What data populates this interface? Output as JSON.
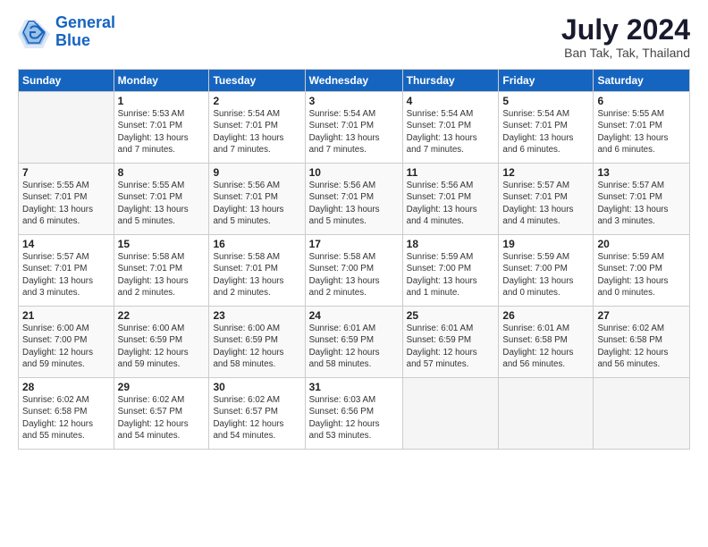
{
  "logo": {
    "line1": "General",
    "line2": "Blue"
  },
  "title": "July 2024",
  "location": "Ban Tak, Tak, Thailand",
  "days_header": [
    "Sunday",
    "Monday",
    "Tuesday",
    "Wednesday",
    "Thursday",
    "Friday",
    "Saturday"
  ],
  "weeks": [
    [
      {
        "num": "",
        "info": ""
      },
      {
        "num": "1",
        "info": "Sunrise: 5:53 AM\nSunset: 7:01 PM\nDaylight: 13 hours\nand 7 minutes."
      },
      {
        "num": "2",
        "info": "Sunrise: 5:54 AM\nSunset: 7:01 PM\nDaylight: 13 hours\nand 7 minutes."
      },
      {
        "num": "3",
        "info": "Sunrise: 5:54 AM\nSunset: 7:01 PM\nDaylight: 13 hours\nand 7 minutes."
      },
      {
        "num": "4",
        "info": "Sunrise: 5:54 AM\nSunset: 7:01 PM\nDaylight: 13 hours\nand 7 minutes."
      },
      {
        "num": "5",
        "info": "Sunrise: 5:54 AM\nSunset: 7:01 PM\nDaylight: 13 hours\nand 6 minutes."
      },
      {
        "num": "6",
        "info": "Sunrise: 5:55 AM\nSunset: 7:01 PM\nDaylight: 13 hours\nand 6 minutes."
      }
    ],
    [
      {
        "num": "7",
        "info": "Sunrise: 5:55 AM\nSunset: 7:01 PM\nDaylight: 13 hours\nand 6 minutes."
      },
      {
        "num": "8",
        "info": "Sunrise: 5:55 AM\nSunset: 7:01 PM\nDaylight: 13 hours\nand 5 minutes."
      },
      {
        "num": "9",
        "info": "Sunrise: 5:56 AM\nSunset: 7:01 PM\nDaylight: 13 hours\nand 5 minutes."
      },
      {
        "num": "10",
        "info": "Sunrise: 5:56 AM\nSunset: 7:01 PM\nDaylight: 13 hours\nand 5 minutes."
      },
      {
        "num": "11",
        "info": "Sunrise: 5:56 AM\nSunset: 7:01 PM\nDaylight: 13 hours\nand 4 minutes."
      },
      {
        "num": "12",
        "info": "Sunrise: 5:57 AM\nSunset: 7:01 PM\nDaylight: 13 hours\nand 4 minutes."
      },
      {
        "num": "13",
        "info": "Sunrise: 5:57 AM\nSunset: 7:01 PM\nDaylight: 13 hours\nand 3 minutes."
      }
    ],
    [
      {
        "num": "14",
        "info": "Sunrise: 5:57 AM\nSunset: 7:01 PM\nDaylight: 13 hours\nand 3 minutes."
      },
      {
        "num": "15",
        "info": "Sunrise: 5:58 AM\nSunset: 7:01 PM\nDaylight: 13 hours\nand 2 minutes."
      },
      {
        "num": "16",
        "info": "Sunrise: 5:58 AM\nSunset: 7:01 PM\nDaylight: 13 hours\nand 2 minutes."
      },
      {
        "num": "17",
        "info": "Sunrise: 5:58 AM\nSunset: 7:00 PM\nDaylight: 13 hours\nand 2 minutes."
      },
      {
        "num": "18",
        "info": "Sunrise: 5:59 AM\nSunset: 7:00 PM\nDaylight: 13 hours\nand 1 minute."
      },
      {
        "num": "19",
        "info": "Sunrise: 5:59 AM\nSunset: 7:00 PM\nDaylight: 13 hours\nand 0 minutes."
      },
      {
        "num": "20",
        "info": "Sunrise: 5:59 AM\nSunset: 7:00 PM\nDaylight: 13 hours\nand 0 minutes."
      }
    ],
    [
      {
        "num": "21",
        "info": "Sunrise: 6:00 AM\nSunset: 7:00 PM\nDaylight: 12 hours\nand 59 minutes."
      },
      {
        "num": "22",
        "info": "Sunrise: 6:00 AM\nSunset: 6:59 PM\nDaylight: 12 hours\nand 59 minutes."
      },
      {
        "num": "23",
        "info": "Sunrise: 6:00 AM\nSunset: 6:59 PM\nDaylight: 12 hours\nand 58 minutes."
      },
      {
        "num": "24",
        "info": "Sunrise: 6:01 AM\nSunset: 6:59 PM\nDaylight: 12 hours\nand 58 minutes."
      },
      {
        "num": "25",
        "info": "Sunrise: 6:01 AM\nSunset: 6:59 PM\nDaylight: 12 hours\nand 57 minutes."
      },
      {
        "num": "26",
        "info": "Sunrise: 6:01 AM\nSunset: 6:58 PM\nDaylight: 12 hours\nand 56 minutes."
      },
      {
        "num": "27",
        "info": "Sunrise: 6:02 AM\nSunset: 6:58 PM\nDaylight: 12 hours\nand 56 minutes."
      }
    ],
    [
      {
        "num": "28",
        "info": "Sunrise: 6:02 AM\nSunset: 6:58 PM\nDaylight: 12 hours\nand 55 minutes."
      },
      {
        "num": "29",
        "info": "Sunrise: 6:02 AM\nSunset: 6:57 PM\nDaylight: 12 hours\nand 54 minutes."
      },
      {
        "num": "30",
        "info": "Sunrise: 6:02 AM\nSunset: 6:57 PM\nDaylight: 12 hours\nand 54 minutes."
      },
      {
        "num": "31",
        "info": "Sunrise: 6:03 AM\nSunset: 6:56 PM\nDaylight: 12 hours\nand 53 minutes."
      },
      {
        "num": "",
        "info": ""
      },
      {
        "num": "",
        "info": ""
      },
      {
        "num": "",
        "info": ""
      }
    ]
  ]
}
